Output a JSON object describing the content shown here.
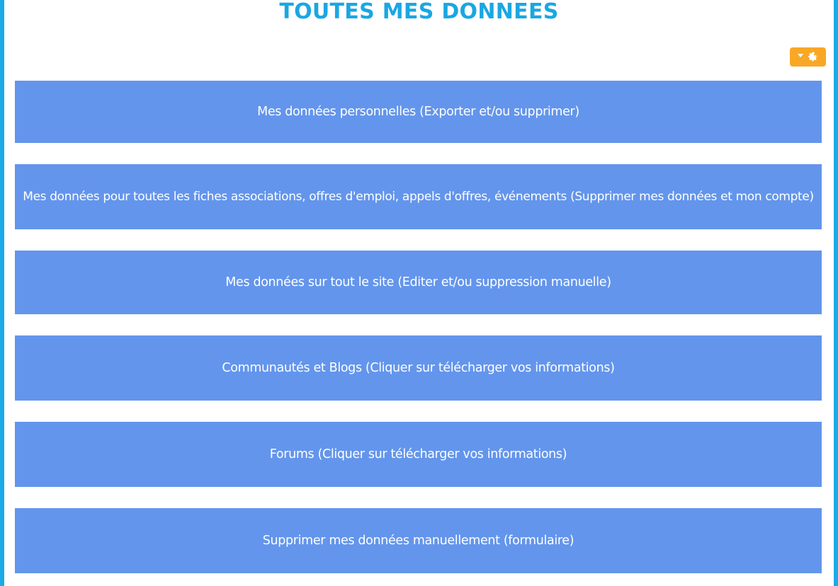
{
  "page": {
    "title": "TOUTES MES DONNEES"
  },
  "toolbar": {
    "settings_icon": "gear-icon",
    "dropdown_icon": "caret-down-icon"
  },
  "tiles": [
    {
      "label": "Mes données personnelles (Exporter et/ou supprimer)"
    },
    {
      "label": "Mes données pour toutes les fiches associations, offres d'emploi, appels d'offres, événements (Supprimer mes données et mon compte)"
    },
    {
      "label": "Mes données sur tout le site (Editer et/ou suppression manuelle)"
    },
    {
      "label": "Communautés et Blogs (Cliquer sur télécharger vos informations)"
    },
    {
      "label": "Forums (Cliquer sur télécharger vos informations)"
    },
    {
      "label": "Supprimer mes données manuellement (formulaire)"
    }
  ],
  "colors": {
    "title": "#1aa7e2",
    "frame": "#1aabe8",
    "tile_bg": "#6395ec",
    "tile_text": "#ffffff",
    "settings_bg": "#f9a825"
  }
}
